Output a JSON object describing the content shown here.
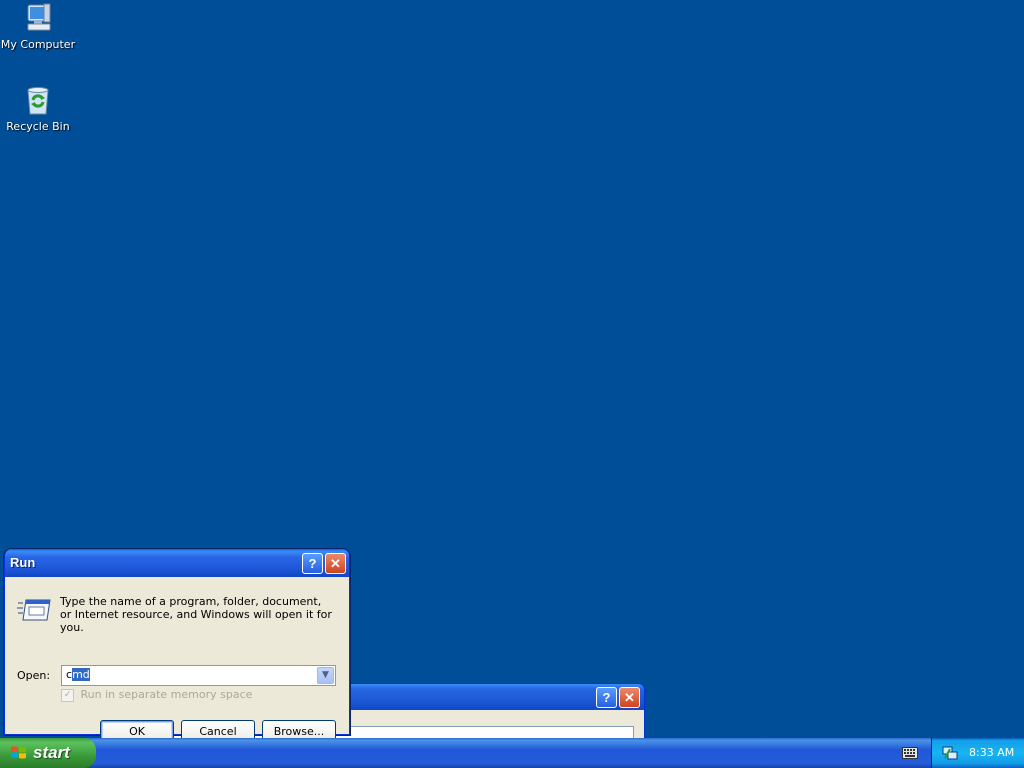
{
  "desktop": {
    "icons": [
      {
        "label": "My Computer",
        "icon": "my-computer-icon"
      },
      {
        "label": "Recycle Bin",
        "icon": "recycle-bin-icon"
      }
    ]
  },
  "run_dialog": {
    "title": "Run",
    "description": "Type the name of a program, folder, document, or Internet resource, and Windows will open it for you.",
    "open_label": "Open:",
    "open_value_prefix": "c",
    "open_value_selected": "md",
    "checkbox_label": "Run in separate memory space",
    "checkbox_checked": true,
    "checkbox_disabled": true,
    "buttons": {
      "ok": "OK",
      "cancel": "Cancel",
      "browse": "Browse..."
    },
    "help_glyph": "?",
    "close_glyph": "✕"
  },
  "background_window": {
    "help_glyph": "?",
    "close_glyph": "✕"
  },
  "taskbar": {
    "start_label": "start",
    "clock": "8:33 AM"
  },
  "colors": {
    "desktop_bg": "#004e98",
    "title_bar": "#2865e6",
    "dialog_bg": "#ece9d8",
    "start_green": "#3a9a3a",
    "tray_blue": "#18b5f2"
  }
}
